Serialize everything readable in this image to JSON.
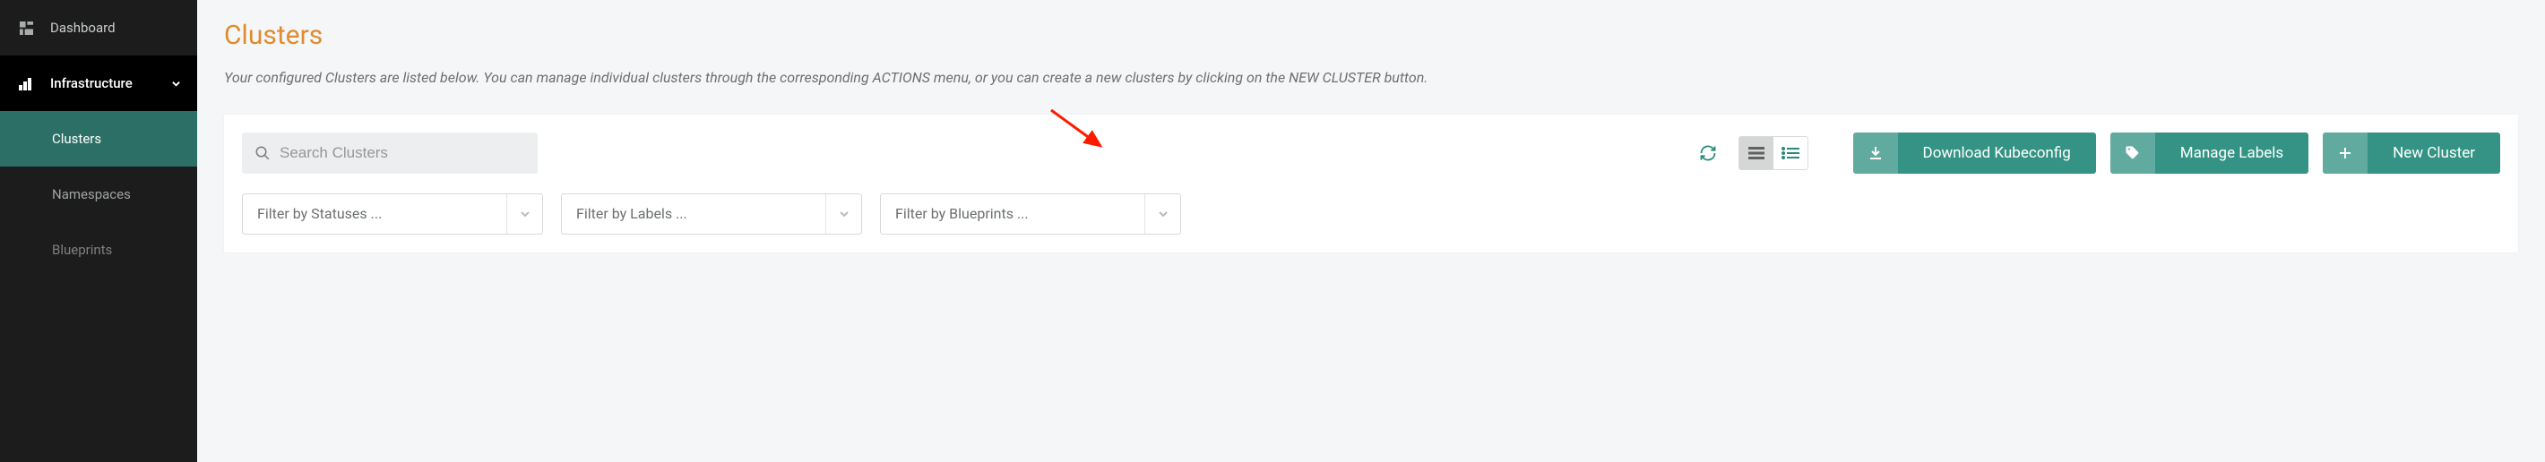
{
  "sidebar": {
    "items": [
      {
        "label": "Dashboard"
      },
      {
        "label": "Infrastructure",
        "expanded": true
      },
      {
        "label": "Clusters",
        "active": true
      },
      {
        "label": "Namespaces"
      },
      {
        "label": "Blueprints"
      }
    ]
  },
  "page": {
    "title": "Clusters",
    "description": "Your configured Clusters are listed below. You can manage individual clusters through the corresponding ACTIONS menu, or you can create a new clusters by clicking on the NEW CLUSTER button."
  },
  "search": {
    "placeholder": "Search Clusters"
  },
  "buttons": {
    "download": "Download Kubeconfig",
    "manage_labels": "Manage Labels",
    "new_cluster": "New Cluster"
  },
  "filters": {
    "status_placeholder": "Filter by Statuses ...",
    "labels_placeholder": "Filter by Labels ...",
    "blueprints_placeholder": "Filter by Blueprints ..."
  },
  "colors": {
    "accent_teal": "#349385",
    "title_orange": "#dd8d2f",
    "sidebar_active": "#2b6f66"
  },
  "annotation": {
    "points_to": "manage-labels-button"
  }
}
